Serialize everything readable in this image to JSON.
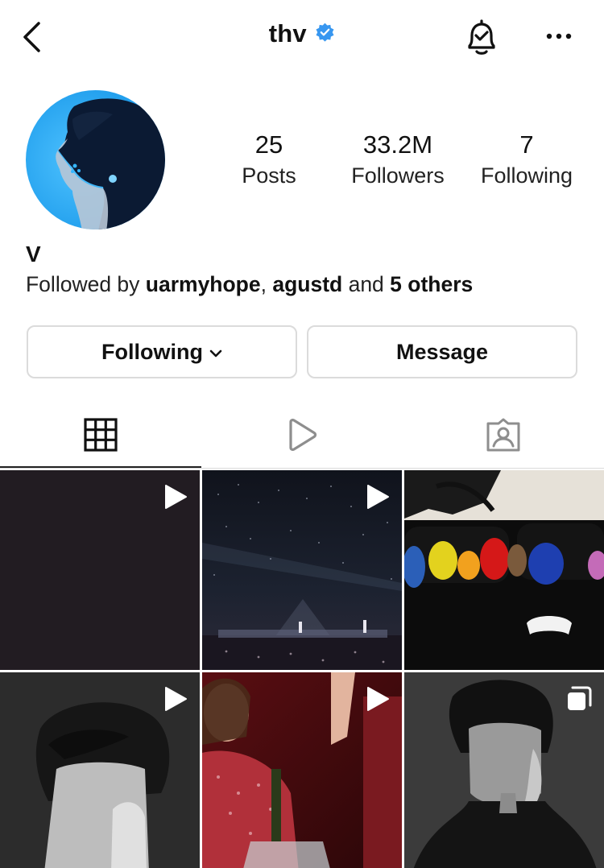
{
  "header": {
    "username": "thv",
    "icons": {
      "back": "chevron-left-icon",
      "verified": "verified-badge-icon",
      "notifications": "bell-check-icon",
      "more": "more-horizontal-icon"
    },
    "verified_color": "#3897f0"
  },
  "profile": {
    "display_name": "V",
    "stats": [
      {
        "value": "25",
        "label": "Posts"
      },
      {
        "value": "33.2M",
        "label": "Followers"
      },
      {
        "value": "7",
        "label": "Following"
      }
    ],
    "followed_by": {
      "prefix": "Followed by ",
      "user1": "uarmyhope",
      "sep": ", ",
      "user2": "agustd",
      "and": " and ",
      "others": "5 others"
    }
  },
  "actions": {
    "following_label": "Following",
    "message_label": "Message"
  },
  "tabs": [
    {
      "icon": "grid-icon",
      "active": true
    },
    {
      "icon": "reels-play-icon",
      "active": false
    },
    {
      "icon": "tagged-person-icon",
      "active": false
    }
  ],
  "posts": [
    {
      "type": "video",
      "subject": "dark plain frame"
    },
    {
      "type": "video",
      "subject": "concert stadium"
    },
    {
      "type": "photo",
      "subject": "plush toys on sofa"
    },
    {
      "type": "video",
      "subject": "black and white portrait"
    },
    {
      "type": "video",
      "subject": "party celebration"
    },
    {
      "type": "carousel",
      "subject": "black and white portrait"
    }
  ]
}
